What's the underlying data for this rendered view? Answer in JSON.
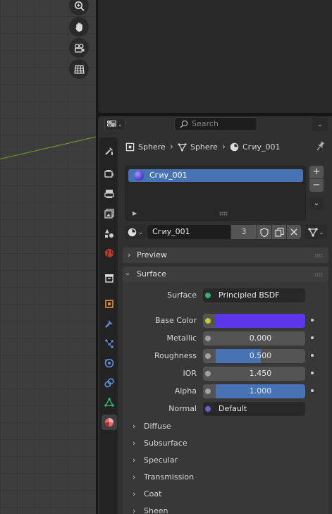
{
  "search": {
    "placeholder": "Search"
  },
  "breadcrumb": {
    "object": "Sphere",
    "mesh": "Sphere",
    "material": "Сгиу_001"
  },
  "material_slots": {
    "items": [
      {
        "label": "Сгиу_001"
      }
    ],
    "add_label": "+",
    "remove_label": "−"
  },
  "material": {
    "name": "Сгиу_001",
    "users": "3"
  },
  "panels": {
    "preview": "Preview",
    "surface": "Surface"
  },
  "surface": {
    "shader_label": "Surface",
    "shader_value": "Principled BSDF",
    "properties": [
      {
        "label": "Base Color",
        "value": "",
        "color": "#5b35e8",
        "socket": "#c7c729"
      },
      {
        "label": "Metallic",
        "value": "0.000",
        "fraction": 0.0,
        "socket": "#a1a1a1"
      },
      {
        "label": "Roughness",
        "value": "0.500",
        "fraction": 0.5,
        "socket": "#a1a1a1"
      },
      {
        "label": "IOR",
        "value": "1.450",
        "fraction": 0.0,
        "socket": "#a1a1a1"
      },
      {
        "label": "Alpha",
        "value": "1.000",
        "fraction": 1.0,
        "socket": "#a1a1a1"
      }
    ],
    "normal_label": "Normal",
    "normal_value": "Default",
    "subpanels": [
      "Diffuse",
      "Subsurface",
      "Specular",
      "Transmission",
      "Coat",
      "Sheen"
    ]
  },
  "colors": {
    "accent": "#4772b3",
    "base_color": "#5b35e8",
    "panel_bg": "#303030"
  },
  "icons": {
    "viewport_tools": [
      "zoom-icon",
      "hand-pan-icon",
      "camera-icon",
      "grid-ortho-icon"
    ],
    "tabs": [
      "tool-icon",
      "render-icon",
      "output-icon",
      "view-layer-icon",
      "scene-icon",
      "world-icon",
      "collection-icon",
      "object-icon",
      "modifier-icon",
      "particles-icon",
      "physics-icon",
      "constraints-icon",
      "object-data-icon",
      "material-icon"
    ]
  }
}
